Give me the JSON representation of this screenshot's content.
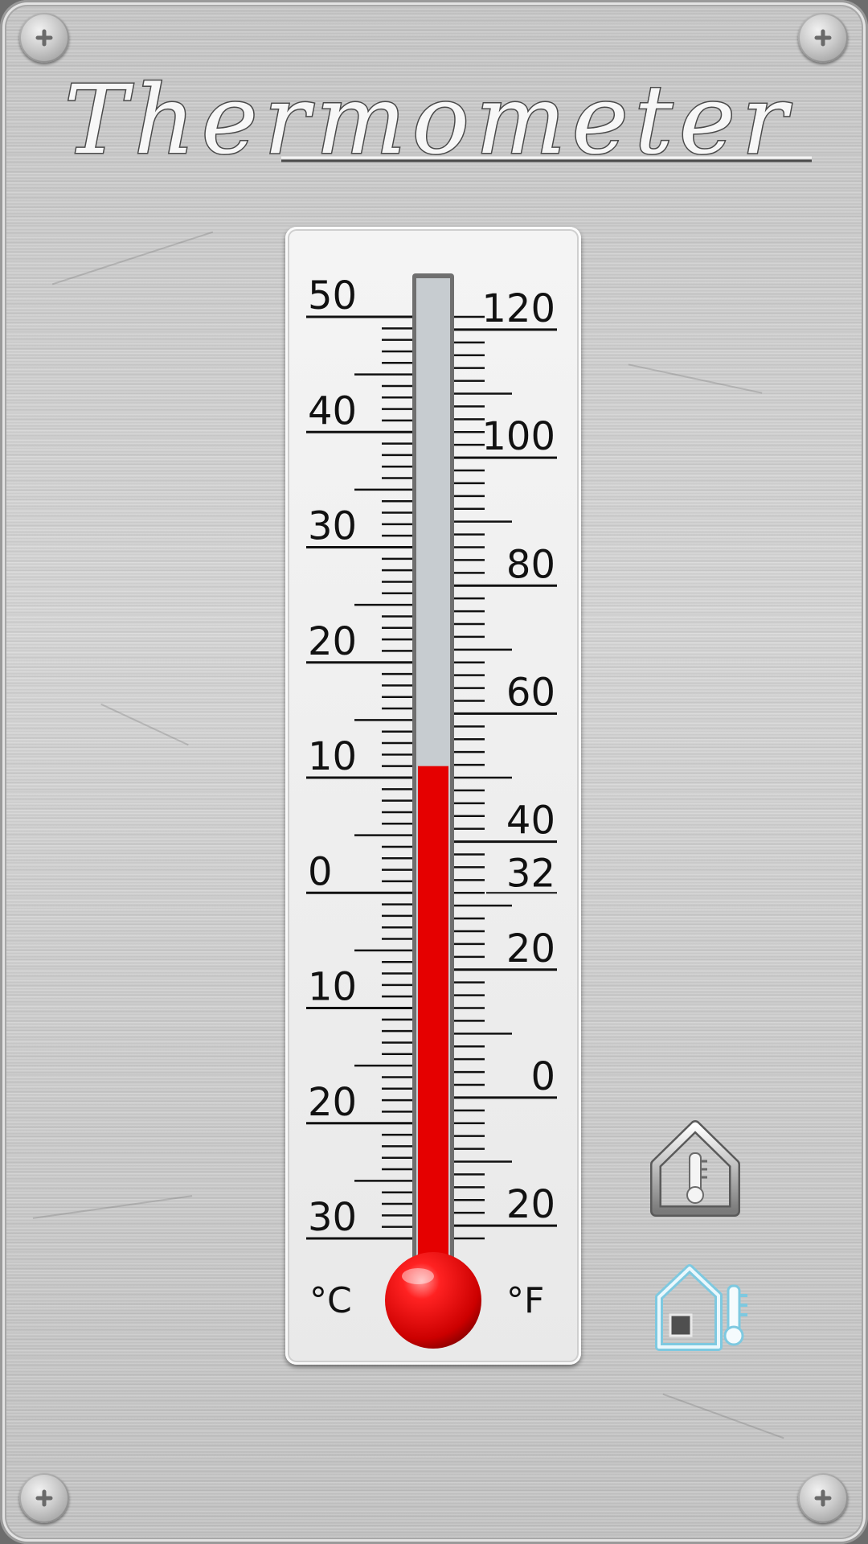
{
  "app": {
    "title": "Thermometer"
  },
  "thermometer": {
    "celsius_unit": "°C",
    "fahrenheit_unit": "°F",
    "celsius_labels": [
      "50",
      "40",
      "30",
      "20",
      "10",
      "0",
      "10",
      "20",
      "30"
    ],
    "fahrenheit_labels": [
      "120",
      "100",
      "80",
      "60",
      "40",
      "32",
      "20",
      "0",
      "20"
    ],
    "current_celsius": 11,
    "mercury_color": "#e50000",
    "empty_tube_color": "#c7ccd0"
  },
  "icons": {
    "screws": [
      "screw-icon",
      "screw-icon",
      "screw-icon",
      "screw-icon"
    ],
    "indoor": "house-thermometer-icon",
    "outdoor": "house-outdoor-thermometer-icon"
  },
  "colors": {
    "panel": "#d3d3d3",
    "scale_card": "#eeeeee",
    "accent_blue": "#8ed3ea"
  }
}
